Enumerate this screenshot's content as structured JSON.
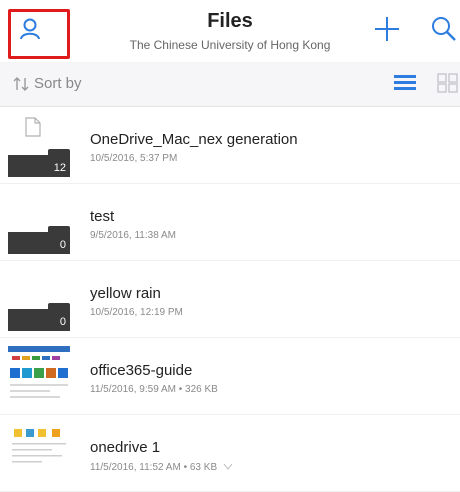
{
  "header": {
    "title": "Files",
    "subtitle": "The Chinese University of Hong Kong"
  },
  "sortbar": {
    "label": "Sort by"
  },
  "files": [
    {
      "name": "OneDrive_Mac_nex generation",
      "meta": "10/5/2016, 5:37 PM",
      "count": "12",
      "kind": "folder"
    },
    {
      "name": "test",
      "meta": "9/5/2016, 11:38 AM",
      "count": "0",
      "kind": "folder"
    },
    {
      "name": "yellow rain",
      "meta": "10/5/2016, 12:19 PM",
      "count": "0",
      "kind": "folder"
    },
    {
      "name": "office365-guide",
      "meta": "11/5/2016, 9:59 AM • 326 KB",
      "kind": "document"
    },
    {
      "name": "onedrive 1",
      "meta": "11/5/2016, 11:52 AM • 63 KB",
      "kind": "image"
    }
  ],
  "colors": {
    "accent": "#2d7de0",
    "highlight": "#e11b1b",
    "folder": "#3a3a3a"
  },
  "icons": {
    "account": "person-icon",
    "add": "plus-icon",
    "search": "search-icon",
    "sort": "sort-arrows-icon",
    "list_view": "list-view-icon",
    "grid_view": "grid-view-icon",
    "offline": "offline-icon"
  }
}
